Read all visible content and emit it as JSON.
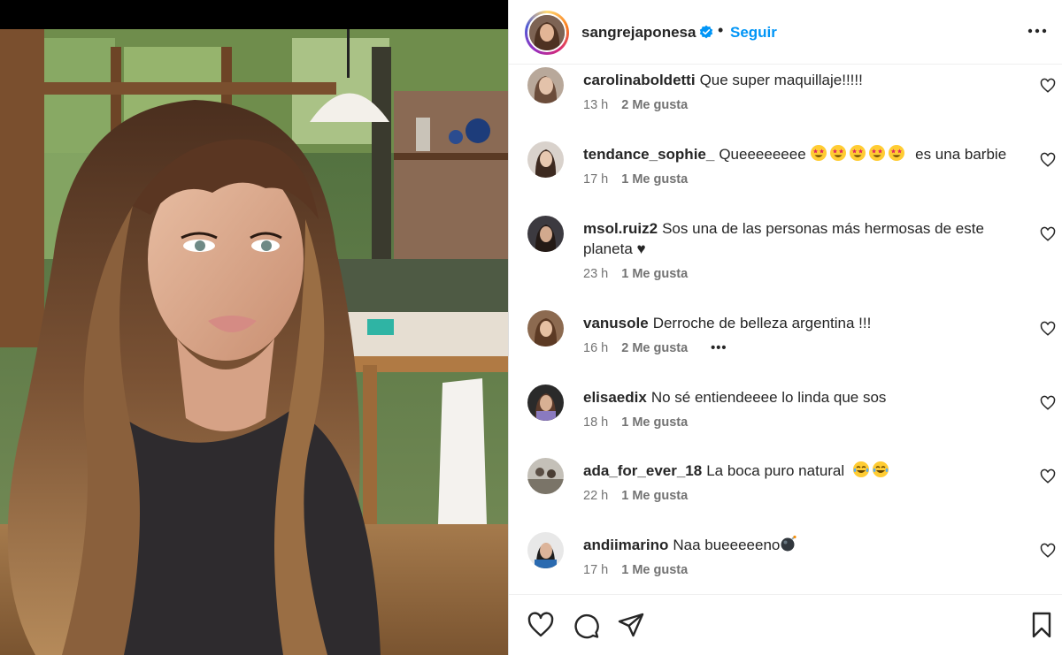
{
  "post": {
    "author": "sangrejaponesa",
    "separator": "•",
    "follow_label": "Seguir",
    "verified": true,
    "accent_color": "#0095f6"
  },
  "comments": [
    {
      "user": "carolinaboldetti",
      "text": "Que super maquillaje!!!!!",
      "emojis": [],
      "time": "13 h",
      "likes": "2 Me gusta",
      "more": ""
    },
    {
      "user": "tendance_sophie_",
      "text": "Queeeeeeee",
      "emojis": [
        "star-struck",
        "star-struck",
        "star-struck",
        "star-struck",
        "star-struck"
      ],
      "text_after": "es una barbie",
      "time": "17 h",
      "likes": "1 Me gusta",
      "more": ""
    },
    {
      "user": "msol.ruiz2",
      "text": "Sos una de las personas más hermosas de este planeta ♥",
      "emojis": [],
      "time": "23 h",
      "likes": "1 Me gusta",
      "more": ""
    },
    {
      "user": "vanusole",
      "text": "Derroche de belleza argentina !!!",
      "emojis": [],
      "time": "16 h",
      "likes": "2 Me gusta",
      "more": "•••"
    },
    {
      "user": "elisaedix",
      "text": "No sé entiendeeee lo linda que sos",
      "emojis": [],
      "time": "18 h",
      "likes": "1 Me gusta",
      "more": ""
    },
    {
      "user": "ada_for_ever_18",
      "text": "La boca puro natural",
      "emojis": [
        "tears-of-joy",
        "tears-of-joy"
      ],
      "time": "22 h",
      "likes": "1 Me gusta",
      "more": ""
    },
    {
      "user": "andiimarino",
      "text": "Naa bueeeeeno",
      "emojis": [
        "bomb"
      ],
      "time": "17 h",
      "likes": "1 Me gusta",
      "more": ""
    }
  ],
  "actions": {
    "like_icon": "heart-outline-icon",
    "comment_icon": "speech-bubble-icon",
    "share_icon": "paper-plane-icon",
    "save_icon": "bookmark-icon"
  }
}
